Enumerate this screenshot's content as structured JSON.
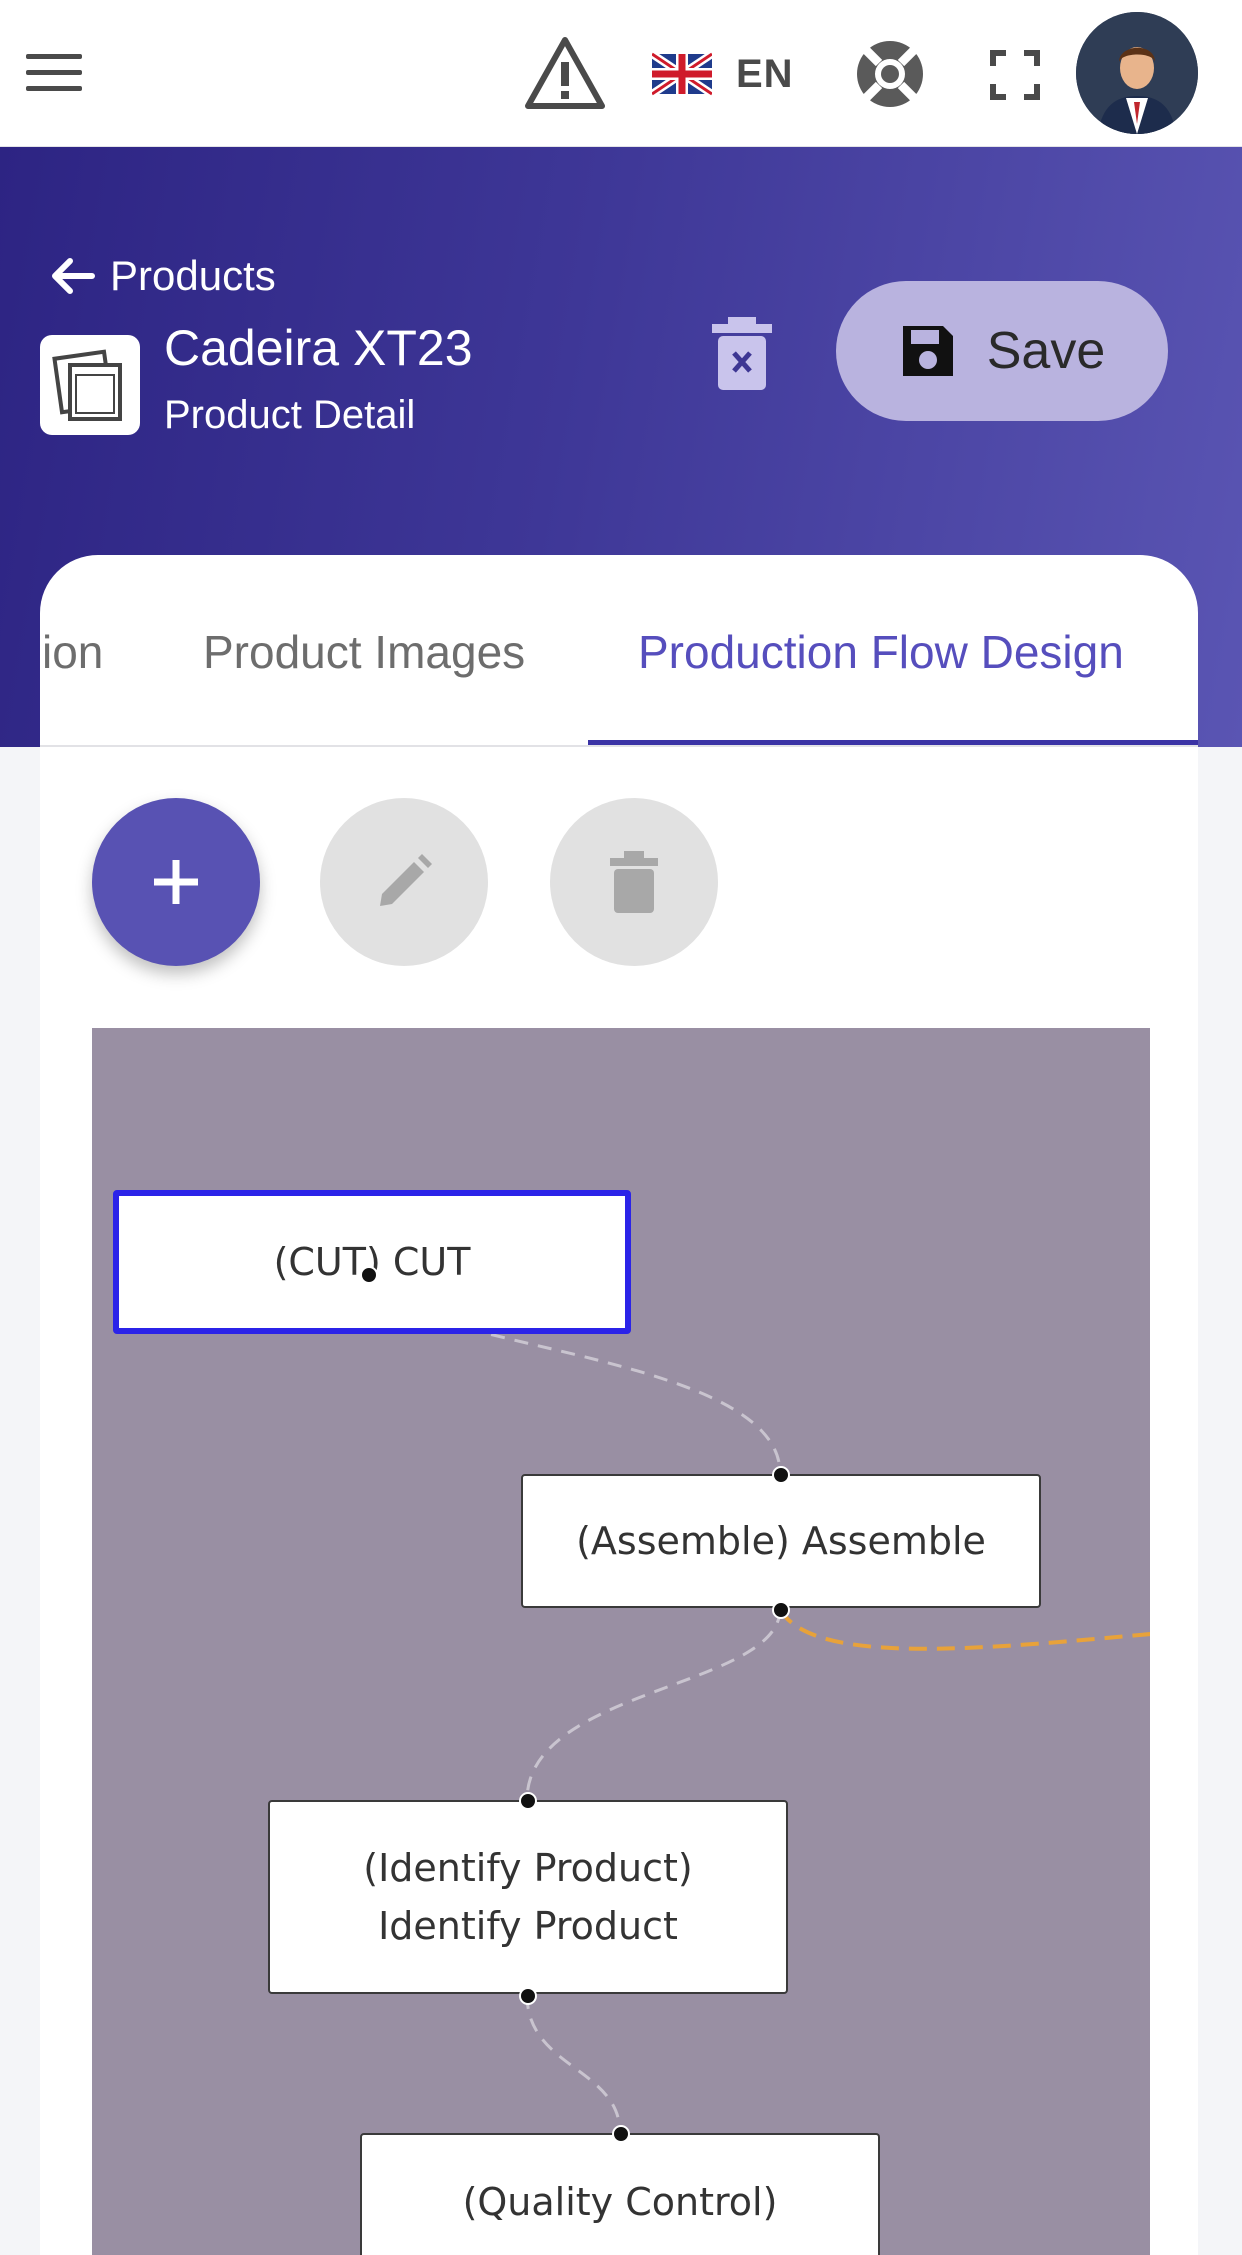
{
  "topbar": {
    "menu_icon": "hamburger-menu-icon",
    "warning_icon": "warning-triangle-icon",
    "language": {
      "flag": "uk-flag-icon",
      "label": "EN"
    },
    "help_icon": "lifebuoy-icon",
    "fullscreen_icon": "fullscreen-icon",
    "avatar": "user-avatar"
  },
  "header": {
    "breadcrumb": "Products",
    "product_title": "Cadeira XT23",
    "product_subtitle": "Product Detail",
    "save_label": "Save"
  },
  "tabs": [
    {
      "label": "ion",
      "active": false
    },
    {
      "label": "Product Images",
      "active": false
    },
    {
      "label": "Production Flow Design",
      "active": true
    }
  ],
  "toolbar": {
    "add_icon": "plus-icon",
    "edit_icon": "pencil-icon",
    "delete_icon": "trash-icon"
  },
  "flow": {
    "nodes": [
      {
        "label": "(CUT) CUT",
        "selected": true
      },
      {
        "label": "(Assemble) Assemble",
        "selected": false
      },
      {
        "label": "(Identify Product) Identify Product",
        "selected": false
      },
      {
        "label": "(Quality Control)",
        "selected": false
      }
    ]
  },
  "colors": {
    "accent": "#5852b3",
    "header_start": "#2d2483",
    "header_end": "#5a55b3",
    "canvas_bg": "#998fa3",
    "selected_border": "#2b23e8",
    "branch_edge": "#e8a23a"
  }
}
